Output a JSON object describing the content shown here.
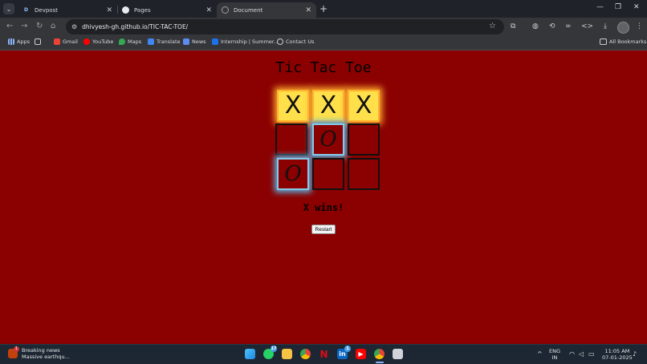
{
  "browser": {
    "tabs": [
      {
        "label": "Devpost",
        "icon": "devpost-icon",
        "active": false
      },
      {
        "label": "Pages",
        "icon": "github-icon",
        "active": false
      },
      {
        "label": "Document",
        "icon": "globe-icon",
        "active": true
      }
    ],
    "url": "dhivyesh-gh.github.io/TIC-TAC-TOE/",
    "bookmarks": [
      {
        "label": "Apps",
        "icon": "apps-grid-icon"
      },
      {
        "label": "",
        "icon": "grid-icon"
      },
      {
        "label": "Gmail",
        "icon": "gmail-icon"
      },
      {
        "label": "YouTube",
        "icon": "youtube-icon"
      },
      {
        "label": "Maps",
        "icon": "maps-icon"
      },
      {
        "label": "Translate",
        "icon": "translate-icon"
      },
      {
        "label": "News",
        "icon": "news-icon"
      },
      {
        "label": "Internship | Summer...",
        "icon": "internshala-icon"
      },
      {
        "label": "Contact Us",
        "icon": "globe-icon"
      }
    ],
    "all_bookmarks": "All Bookmarks"
  },
  "game": {
    "title": "Tic Tac Toe",
    "board": [
      "X",
      "X",
      "X",
      "",
      "O",
      "",
      "O",
      "",
      ""
    ],
    "status": "X wins!",
    "restart_label": "Restart"
  },
  "taskbar": {
    "news_title": "Breaking news",
    "news_sub": "Massive earthqu...",
    "news_badge": "1",
    "whatsapp_badge": "17",
    "linkedin_badge": "1",
    "lang_line1": "ENG",
    "lang_line2": "IN",
    "time": "11:05 AM",
    "date": "07-01-2025"
  },
  "colors": {
    "page_bg": "#8b0000",
    "win_cell": "#ffe04a",
    "glow": "#57b2e0",
    "chrome": "#35363a"
  }
}
